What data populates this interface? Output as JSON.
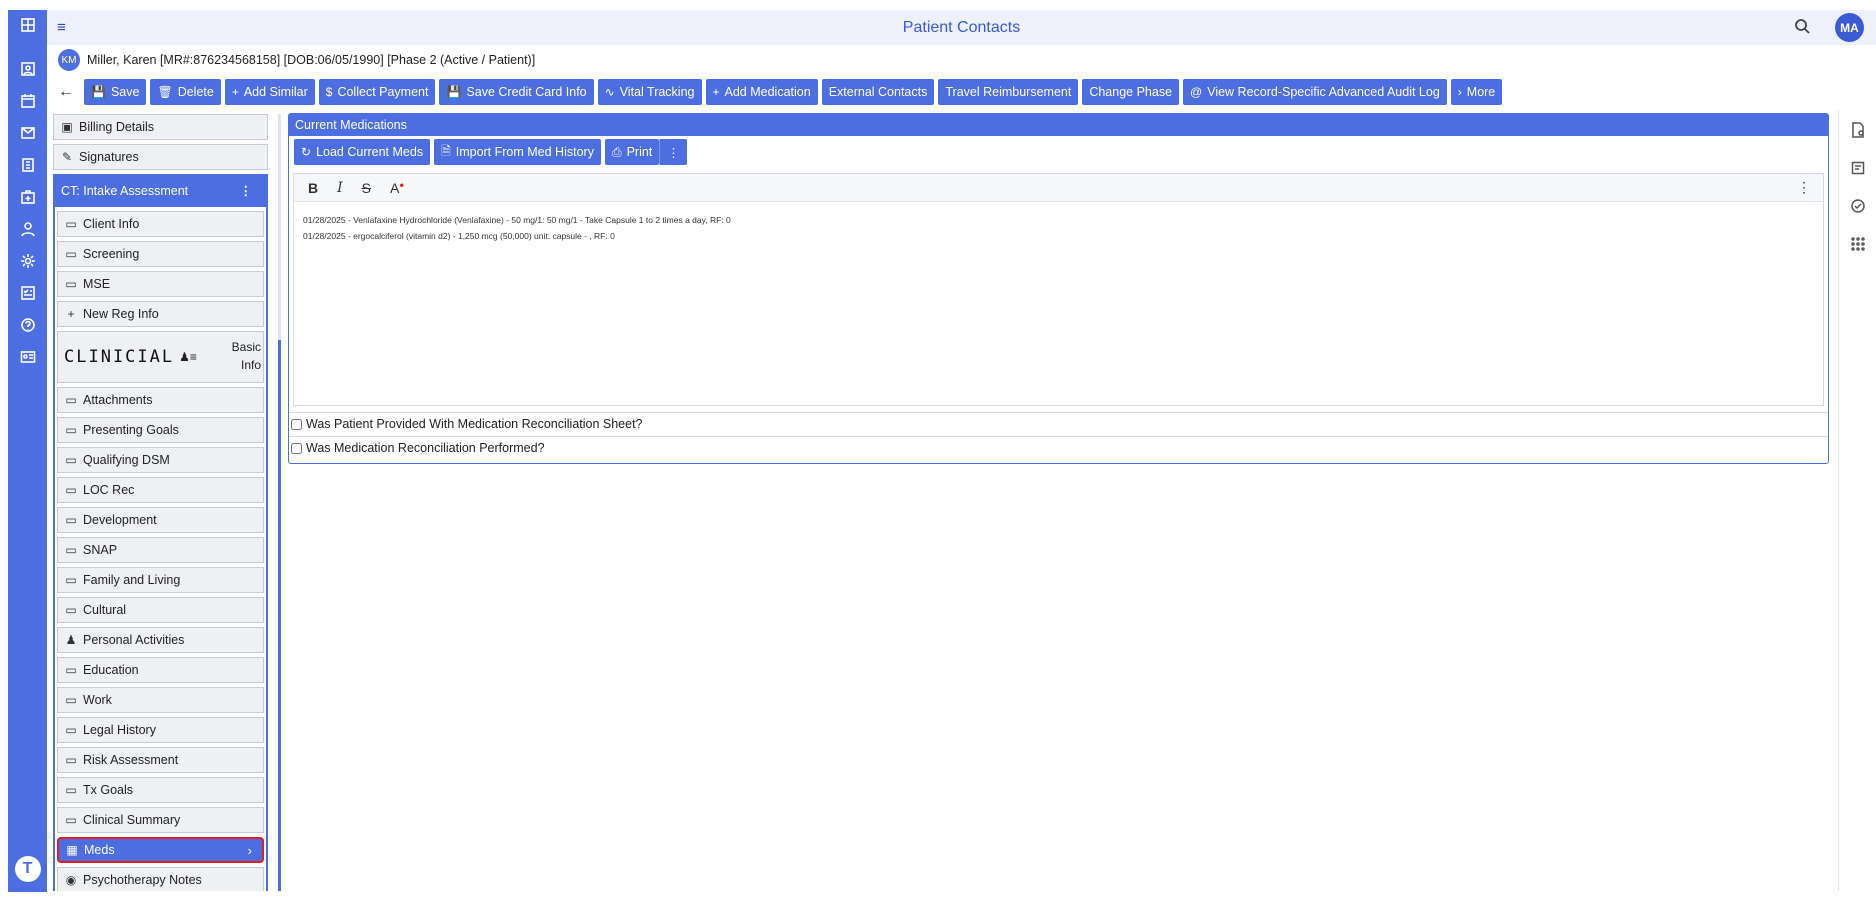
{
  "header": {
    "title": "Patient Contacts",
    "user_initials": "MA"
  },
  "patient": {
    "initials": "KM",
    "line": "Miller, Karen [MR#:876234568158] [DOB:06/05/1990] [Phase 2 (Active / Patient)]"
  },
  "toolbar": {
    "save": "Save",
    "delete": "Delete",
    "add_similar": "Add Similar",
    "collect_payment": "Collect Payment",
    "save_credit_card": "Save Credit Card Info",
    "vital_tracking": "Vital Tracking",
    "add_medication": "Add Medication",
    "external_contacts": "External Contacts",
    "travel_reimbursement": "Travel Reimbursement",
    "change_phase": "Change Phase",
    "audit_log": "View Record-Specific Advanced Audit Log",
    "more": "More"
  },
  "sidebar": {
    "top_items": [
      {
        "label": "Billing Details",
        "icon": "credit-card-icon"
      },
      {
        "label": "Signatures",
        "icon": "signature-icon"
      }
    ],
    "group_title": "CT: Intake Assessment",
    "items": [
      "Client Info",
      "Screening",
      "MSE",
      "New Reg Info",
      "CLINICIAL",
      "Attachments",
      "Presenting Goals",
      "Qualifying DSM",
      "LOC Rec",
      "Development",
      "SNAP",
      "Family and Living",
      "Cultural",
      "Personal Activities",
      "Education",
      "Work",
      "Legal History",
      "Risk Assessment",
      "Tx Goals",
      "Clinical Summary",
      "Meds",
      "Psychotherapy Notes"
    ],
    "clinical_side_top": "Basic",
    "clinical_side_bottom": "Info",
    "active_item": "Meds"
  },
  "panel": {
    "title": "Current Medications",
    "load_meds": "Load Current Meds",
    "import_history": "Import From Med History",
    "print": "Print",
    "med_lines": [
      "01/28/2025 - Venlafaxine Hydrochloride (Venlafaxine) - 50 mg/1: 50 mg/1 - Take Capsule 1 to 2 times a day, RF: 0",
      "01/28/2025 - ergocalciferol (vitamin d2) - 1,250 mcg (50,000) unit: capsule - , RF: 0"
    ],
    "check1": "Was Patient Provided With Medication Reconciliation Sheet?",
    "check2": "Was Medication Reconciliation Performed?"
  },
  "colors": {
    "accent": "#4d6ee0",
    "highlight": "#e31b23",
    "header_bg": "#eef1fb"
  }
}
